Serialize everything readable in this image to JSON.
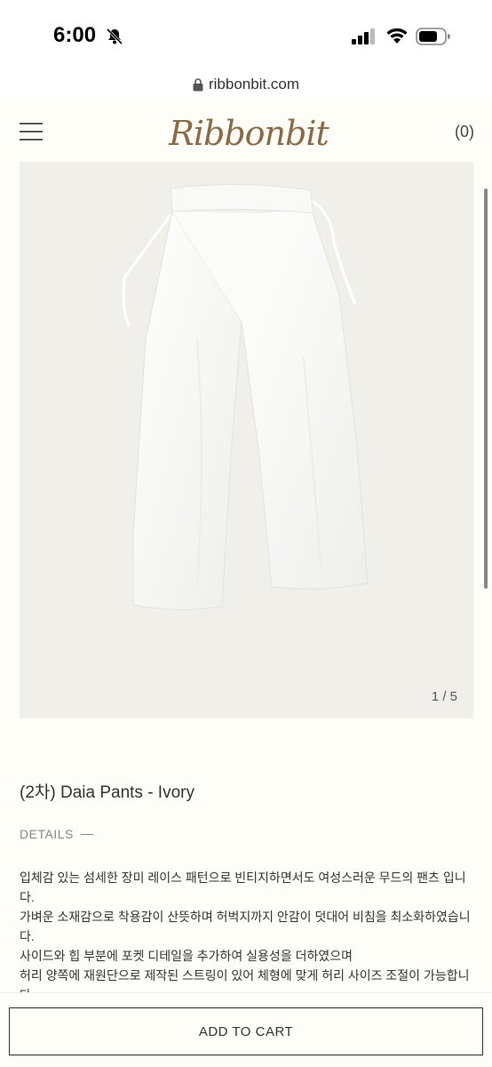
{
  "status_bar": {
    "time": "6:00"
  },
  "browser": {
    "url": "ribbonbit.com"
  },
  "header": {
    "logo": "Ribbonbit",
    "cart_count": "(0)"
  },
  "gallery": {
    "counter": "1 / 5"
  },
  "product": {
    "title": "(2차) Daia Pants - Ivory",
    "details_label": "DETAILS",
    "description": [
      "입체감 있는 섬세한 장미 레이스 패턴으로 빈티지하면서도 여성스러운 무드의 팬츠 입니다.",
      "가벼운 소재감으로 착용감이 산뜻하며 허벅지까지 안감이 덧대어 비침을 최소화하였습니다.",
      "사이드와 힙 부분에 포켓 디테일을 추가하여 실용성을 더하였으며",
      "허리 양쪽에 재원단으로 제작된 스트링이 있어 체형에 맞게 허리 사이즈 조절이 가능합니다."
    ]
  },
  "cart_button": {
    "label": "ADD TO CART"
  },
  "colors": {
    "logo": "#8b6a45",
    "background": "#fffdf8",
    "image_bg": "#f0efea"
  }
}
